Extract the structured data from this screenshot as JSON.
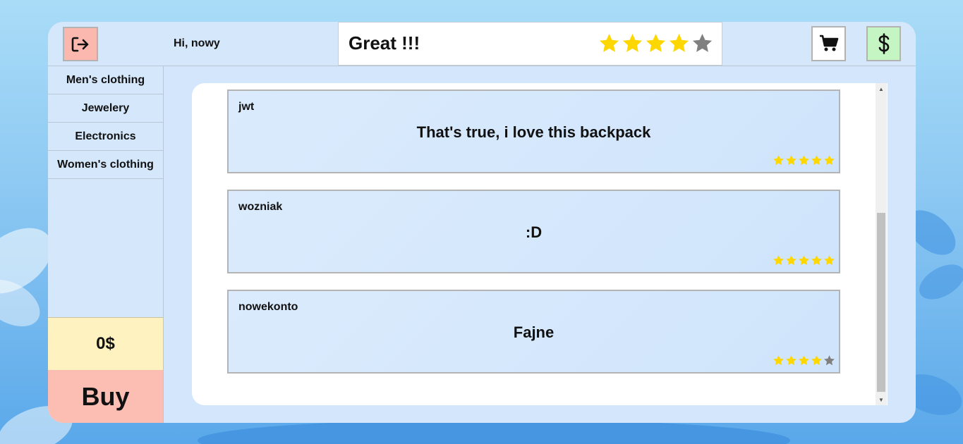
{
  "header": {
    "greeting": "Hi, nowy",
    "logout_icon": "logout-icon",
    "cart_icon": "cart-icon",
    "money_icon": "dollar-icon"
  },
  "product_rating": {
    "label": "Great !!!",
    "stars": 4,
    "max_stars": 5
  },
  "sidebar": {
    "categories": [
      {
        "label": "Men's clothing"
      },
      {
        "label": "Jewelery"
      },
      {
        "label": "Electronics"
      },
      {
        "label": "Women's clothing"
      }
    ],
    "balance": "0$",
    "buy_label": "Buy"
  },
  "reviews": [
    {
      "user": "jwt",
      "text": "That's true, i love this backpack",
      "stars": 5
    },
    {
      "user": "wozniak",
      "text": ":D",
      "stars": 5
    },
    {
      "user": "nowekonto",
      "text": "Fajne",
      "stars": 4
    }
  ],
  "colors": {
    "star_filled": "#ffd700",
    "star_empty": "#808080",
    "logout_bg": "#fbb8ae",
    "money_bg": "#c4f5c2",
    "balance_bg": "#fef2c0",
    "buy_bg": "#fcbeb3"
  }
}
